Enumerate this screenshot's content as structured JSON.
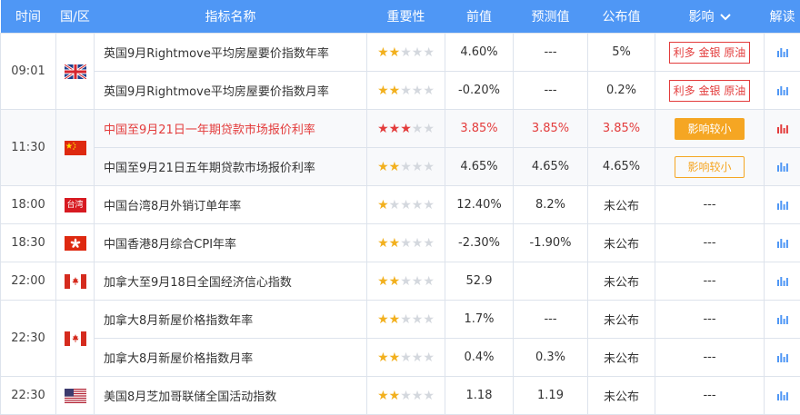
{
  "headers": {
    "time": "时间",
    "country": "国/区",
    "name": "指标名称",
    "importance": "重要性",
    "previous": "前值",
    "forecast": "预测值",
    "actual": "公布值",
    "impact": "影响",
    "analysis": "解读"
  },
  "colors": {
    "header_bg": "#4f97f5",
    "star": "#f2b01e",
    "star_red": "#e33c3c",
    "bullish": "#e33c3c",
    "low_impact": "#f5a623"
  },
  "times": [
    "09:01",
    "11:30",
    "18:00",
    "18:30",
    "22:00",
    "22:30",
    "22:30"
  ],
  "flags": {
    "tw_label": "台湾"
  },
  "rows": [
    {
      "name": "英国9月Rightmove平均房屋要价指数年率",
      "stars": 2,
      "previous": "4.60%",
      "forecast": "---",
      "actual": "5%",
      "impact": "利多 金银 原油",
      "country": "uk-flag"
    },
    {
      "name": "英国9月Rightmove平均房屋要价指数月率",
      "stars": 2,
      "previous": "-0.20%",
      "forecast": "---",
      "actual": "0.2%",
      "impact": "利多 金银 原油",
      "country": "uk-flag"
    },
    {
      "name": "中国至9月21日一年期贷款市场报价利率",
      "stars": 3,
      "previous": "3.85%",
      "forecast": "3.85%",
      "actual": "3.85%",
      "impact": "影响较小",
      "country": "china-flag"
    },
    {
      "name": "中国至9月21日五年期贷款市场报价利率",
      "stars": 2,
      "previous": "4.65%",
      "forecast": "4.65%",
      "actual": "4.65%",
      "impact": "影响较小",
      "country": "china-flag"
    },
    {
      "name": "中国台湾8月外销订单年率",
      "stars": 1,
      "previous": "12.40%",
      "forecast": "8.2%",
      "actual": "未公布",
      "impact": "---",
      "country": "taiwan-flag"
    },
    {
      "name": "中国香港8月综合CPI年率",
      "stars": 2,
      "previous": "-2.30%",
      "forecast": "-1.90%",
      "actual": "未公布",
      "impact": "---",
      "country": "hongkong-flag"
    },
    {
      "name": "加拿大至9月18日全国经济信心指数",
      "stars": 2,
      "previous": "52.9",
      "forecast": "",
      "actual": "未公布",
      "impact": "---",
      "country": "canada-flag"
    },
    {
      "name": "加拿大8月新屋价格指数年率",
      "stars": 2,
      "previous": "1.7%",
      "forecast": "---",
      "actual": "未公布",
      "impact": "---",
      "country": "canada-flag"
    },
    {
      "name": "加拿大8月新屋价格指数月率",
      "stars": 2,
      "previous": "0.4%",
      "forecast": "0.3%",
      "actual": "未公布",
      "impact": "---",
      "country": "canada-flag"
    },
    {
      "name": "美国8月芝加哥联储全国活动指数",
      "stars": 2,
      "previous": "1.18",
      "forecast": "1.19",
      "actual": "未公布",
      "impact": "---",
      "country": "us-flag"
    }
  ]
}
